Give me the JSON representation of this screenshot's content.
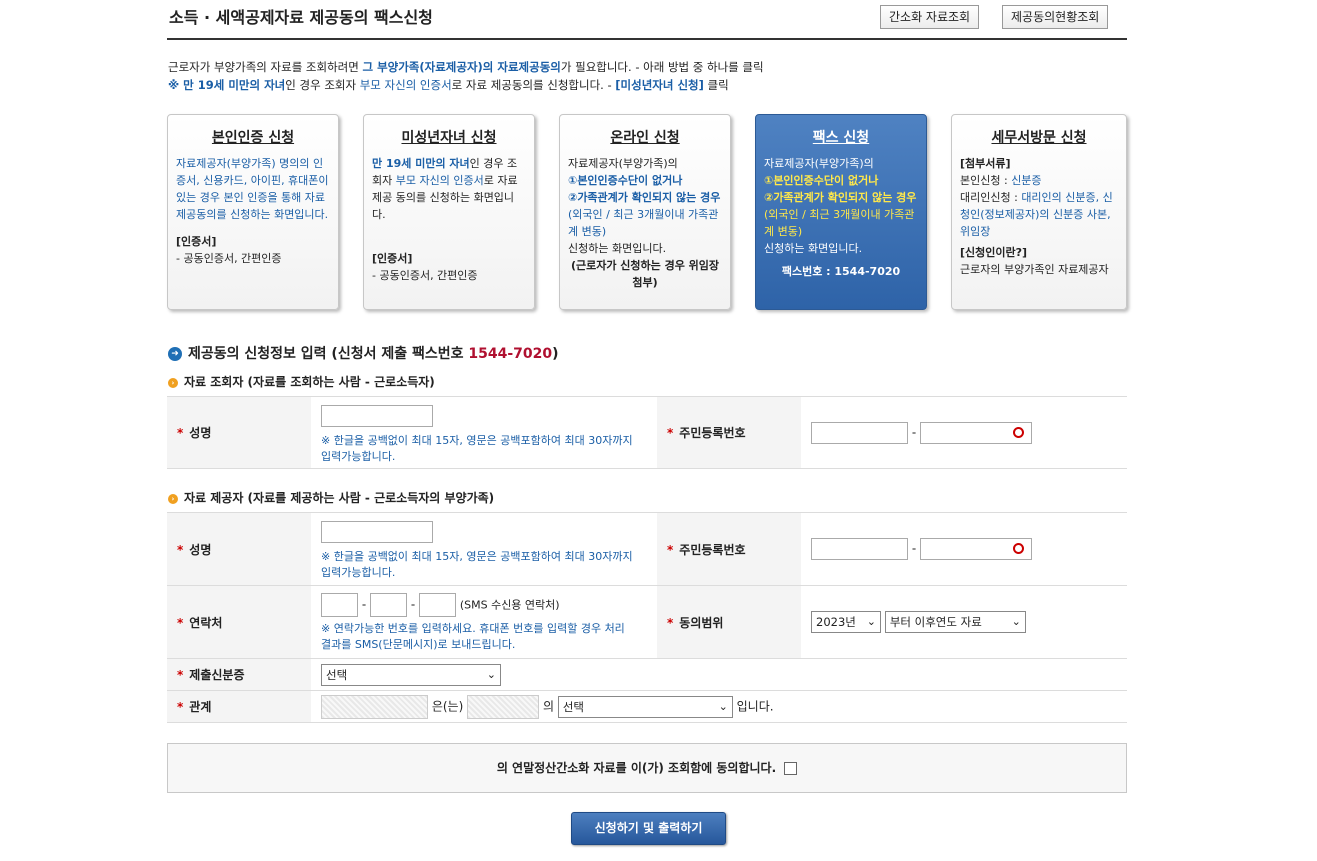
{
  "header": {
    "title": "소득 · 세액공제자료 제공동의 팩스신청",
    "btn_simple": "간소화 자료조회",
    "btn_status": "제공동의현황조회"
  },
  "intro": {
    "l1a": "근로자가 부양가족의 자료를 조회하려면 ",
    "l1b": "그 부양가족(자료제공자)의 자료제공동의",
    "l1c": "가 필요합니다. - 아래 방법 중 하나를 클릭",
    "l2a": "※ 만 19세 미만의 자녀",
    "l2b": "인 경우 조회자 ",
    "l2c": "부모 자신의 인증서",
    "l2d": "로 자료 제공동의를 신청합니다. - ",
    "l2e": "[미성년자녀 신청]",
    "l2f": " 클릭"
  },
  "cards": {
    "self": {
      "title": "본인인증 신청",
      "desc": "자료제공자(부양가족) 명의의 인증서, 신용카드, 아이핀,  휴대폰이 있는 경우 본인 인증을 통해 자료제공동의를 신청하는 화면입니다.",
      "cert_label": "[인증서]",
      "cert_text": "- 공동인증서, 간편인증"
    },
    "minor": {
      "title": "미성년자녀 신청",
      "d1": "만 19세 미만의 자녀",
      "d2": "인 경우 조회자 ",
      "d3": "부모 자신의 인증서",
      "d4": "로 자료 제공 동의를 신청하는 화면입니다.",
      "cert_label": "[인증서]",
      "cert_text": "- 공동인증서, 간편인증"
    },
    "online": {
      "title": "온라인 신청",
      "d1": "자료제공자(부양가족)의",
      "d2": "①본인인증수단이 없거나",
      "d3": "②가족관계가 확인되지 않는 경우",
      "d4": "(외국인 / 최근 3개월이내 가족관계 변동)",
      "d5": "신청하는 화면입니다.",
      "d6": "(근로자가 신청하는 경우 위임장 첨부)"
    },
    "fax": {
      "title": "팩스 신청",
      "d1": "자료제공자(부양가족)의",
      "d2": "①본인인증수단이 없거나",
      "d3": "②가족관계가 확인되지 않는 경우",
      "d4": "(외국인 / 최근 3개월이내 가족관계 변동)",
      "d5": "신청하는 화면입니다.",
      "fax_no": "팩스번호 : 1544-7020"
    },
    "visit": {
      "title": "세무서방문 신청",
      "h1": "[첨부서류]",
      "s1a": "본인신청 : ",
      "s1b": "신분증",
      "s2a": "대리인신청 : ",
      "s2b": "대리인의 신분증, 신청인(정보제공자)의 신분증 사본, 위임장",
      "h2": "[신청인이란?]",
      "s3": "근로자의 부양가족인 자료제공자"
    }
  },
  "section_main": {
    "prefix": "제공동의 신청정보 입력 (신청서 제출 팩스번호 ",
    "fax": "1544-7020",
    "suffix": ")"
  },
  "viewer": {
    "heading": "자료 조회자 (자료를 조회하는 사람 - 근로소득자)",
    "name_label": "성명",
    "name_note": "※ 한글을 공백없이 최대 15자, 영문은 공백포함하여 최대 30자까지 입력가능합니다.",
    "rrn_label": "주민등록번호",
    "dash": "-"
  },
  "provider": {
    "heading": "자료 제공자 (자료를 제공하는 사람 - 근로소득자의 부양가족)",
    "name_label": "성명",
    "name_note": "※ 한글을 공백없이 최대 15자, 영문은 공백포함하여 최대 30자까지 입력가능합니다.",
    "rrn_label": "주민등록번호",
    "dash": "-",
    "contact_label": "연락처",
    "contact_sms": "(SMS 수신용 연락처)",
    "contact_note": "※ 연락가능한 번호를 입력하세요. 휴대폰 번호를 입력할 경우 처리 결과를 SMS(단문메시지)로 보내드립니다.",
    "scope_label": "동의범위",
    "scope_year": "2023년",
    "scope_range": "부터 이후연도 자료",
    "id_label": "제출신분증",
    "id_value": "선택",
    "rel_label": "관계",
    "rel_eun": "은(는)",
    "rel_ui": "의",
    "rel_value": "선택",
    "rel_end": "입니다."
  },
  "agree": {
    "text": "의 연말정산간소화 자료를 이(가) 조회함에 동의합니다."
  },
  "submit": {
    "label": "신청하기 및 출력하기"
  },
  "colors": {
    "accent_blue": "#1a5ea6",
    "selected_card": "#3a6fb3",
    "fax_red": "#b01030",
    "highlight_yellow": "#ffe84a"
  }
}
